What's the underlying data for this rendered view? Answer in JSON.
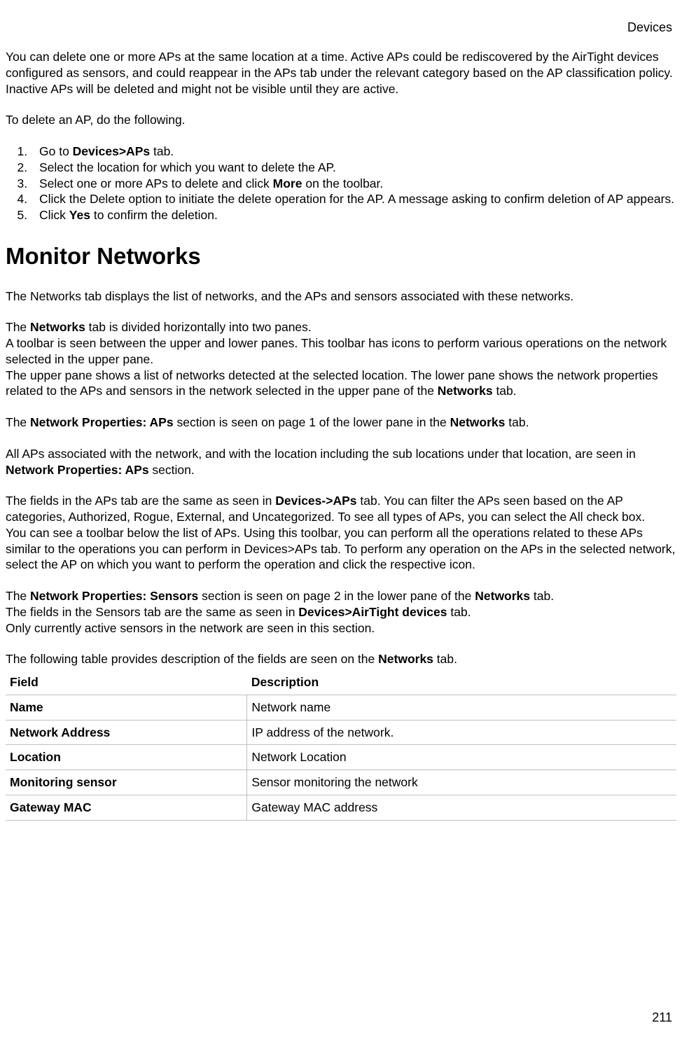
{
  "header": {
    "section_title": "Devices"
  },
  "intro": {
    "p1": "You can delete one or more APs at the same location at a time. Active APs could be rediscovered by the AirTight devices configured as sensors, and could reappear in the APs tab under the relevant category based on the AP classification policy.",
    "p2": "Inactive APs will be deleted and might not be visible until they are active.",
    "p3": "To delete an AP, do the following."
  },
  "steps": {
    "s1_pre": "Go to ",
    "s1_bold": "Devices>APs",
    "s1_post": " tab.",
    "s2": "Select the location for which you want to delete the AP.",
    "s3_pre": "Select one or more APs to delete and click ",
    "s3_bold": "More",
    "s3_post": " on the toolbar.",
    "s4": "Click the Delete option to initiate the delete operation for the AP. A message asking to confirm deletion of AP appears.",
    "s5_pre": "Click ",
    "s5_bold": "Yes",
    "s5_post": " to confirm the deletion."
  },
  "heading": "Monitor Networks",
  "body": {
    "b1": "The Networks tab displays the list of networks, and the APs and sensors associated with these networks.",
    "b2_pre": "The ",
    "b2_bold": "Networks",
    "b2_post": " tab is divided horizontally into two panes.",
    "b3": "A toolbar is seen between the upper and lower panes. This toolbar has icons to perform various operations on the network selected in the upper pane.",
    "b4_pre": "The upper pane shows a list of networks detected at the selected location. The lower pane shows the network properties related to the APs and sensors in the network selected in the upper pane of the ",
    "b4_bold": "Networks",
    "b4_post": " tab.",
    "b5_pre": "The ",
    "b5_bold1": "Network Properties: APs",
    "b5_mid": " section is seen on page 1 of the lower pane in the ",
    "b5_bold2": "Networks",
    "b5_post": " tab.",
    "b6_pre": "All APs associated with the network, and with the location including the sub locations under that location, are seen in ",
    "b6_bold": "Network Properties: APs",
    "b6_post": " section.",
    "b7_pre": "The fields in the APs tab are the same as seen in ",
    "b7_bold": "Devices->APs",
    "b7_post": " tab. You can filter the APs seen based on the AP categories, Authorized, Rogue, External, and Uncategorized. To see all types of APs, you can select the All check box.",
    "b8": "You can see a toolbar below the list of APs. Using this toolbar, you can perform all the operations related to these APs similar to the operations you can perform in Devices>APs tab. To perform any operation on the APs in the selected network, select the AP on which you want to perform the operation and click the respective icon.",
    "b9_pre": "The ",
    "b9_bold1": "Network Properties: Sensors",
    "b9_mid": " section is seen on page 2 in the lower pane of the ",
    "b9_bold2": "Networks",
    "b9_post": " tab.",
    "b10_pre": "The fields in the Sensors tab are the same as seen in ",
    "b10_bold": "Devices>AirTight devices",
    "b10_post": " tab.",
    "b11": "Only currently active sensors in the network are seen in this section.",
    "b12_pre": "The following table provides description of the fields are seen on the ",
    "b12_bold": "Networks",
    "b12_post": " tab."
  },
  "table": {
    "headers": {
      "field": "Field",
      "description": "Description"
    },
    "rows": [
      {
        "field": "Name",
        "description": "Network name"
      },
      {
        "field": "Network Address",
        "description": "IP address of the network."
      },
      {
        "field": "Location",
        "description": "Network Location"
      },
      {
        "field": "Monitoring sensor",
        "description": "Sensor monitoring the network"
      },
      {
        "field": "Gateway MAC",
        "description": "Gateway MAC address"
      }
    ]
  },
  "footer": {
    "page_number": "211"
  }
}
